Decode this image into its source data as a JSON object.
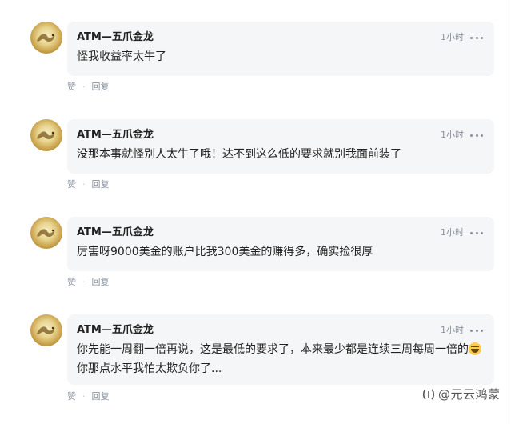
{
  "comments": [
    {
      "author": "ATM—五爪金龙",
      "time": "1小时",
      "text": "怪我收益率太牛了",
      "like": "赞",
      "reply": "回复"
    },
    {
      "author": "ATM—五爪金龙",
      "time": "1小时",
      "text": "没那本事就怪别人太牛了哦！达不到这么低的要求就别我面前装了",
      "like": "赞",
      "reply": "回复"
    },
    {
      "author": "ATM—五爪金龙",
      "time": "1小时",
      "text": "厉害呀9000美金的账户比我300美金的赚得多，确实捡很厚",
      "like": "赞",
      "reply": "回复"
    },
    {
      "author": "ATM—五爪金龙",
      "time": "1小时",
      "text_before_emoji": "你先能一周翻一倍再说，这是最低的要求了，本来最少都是连续三周每周一倍的",
      "emoji": "grinning-face-emoji",
      "text_after_emoji": "你那点水平我怕太欺负你了...",
      "like": "赞",
      "reply": "回复"
    }
  ],
  "watermark": "@元云鸿蒙",
  "colors": {
    "bubble_bg": "#f5f6f7",
    "meta_text": "#8a919f",
    "body_text": "#222222"
  }
}
